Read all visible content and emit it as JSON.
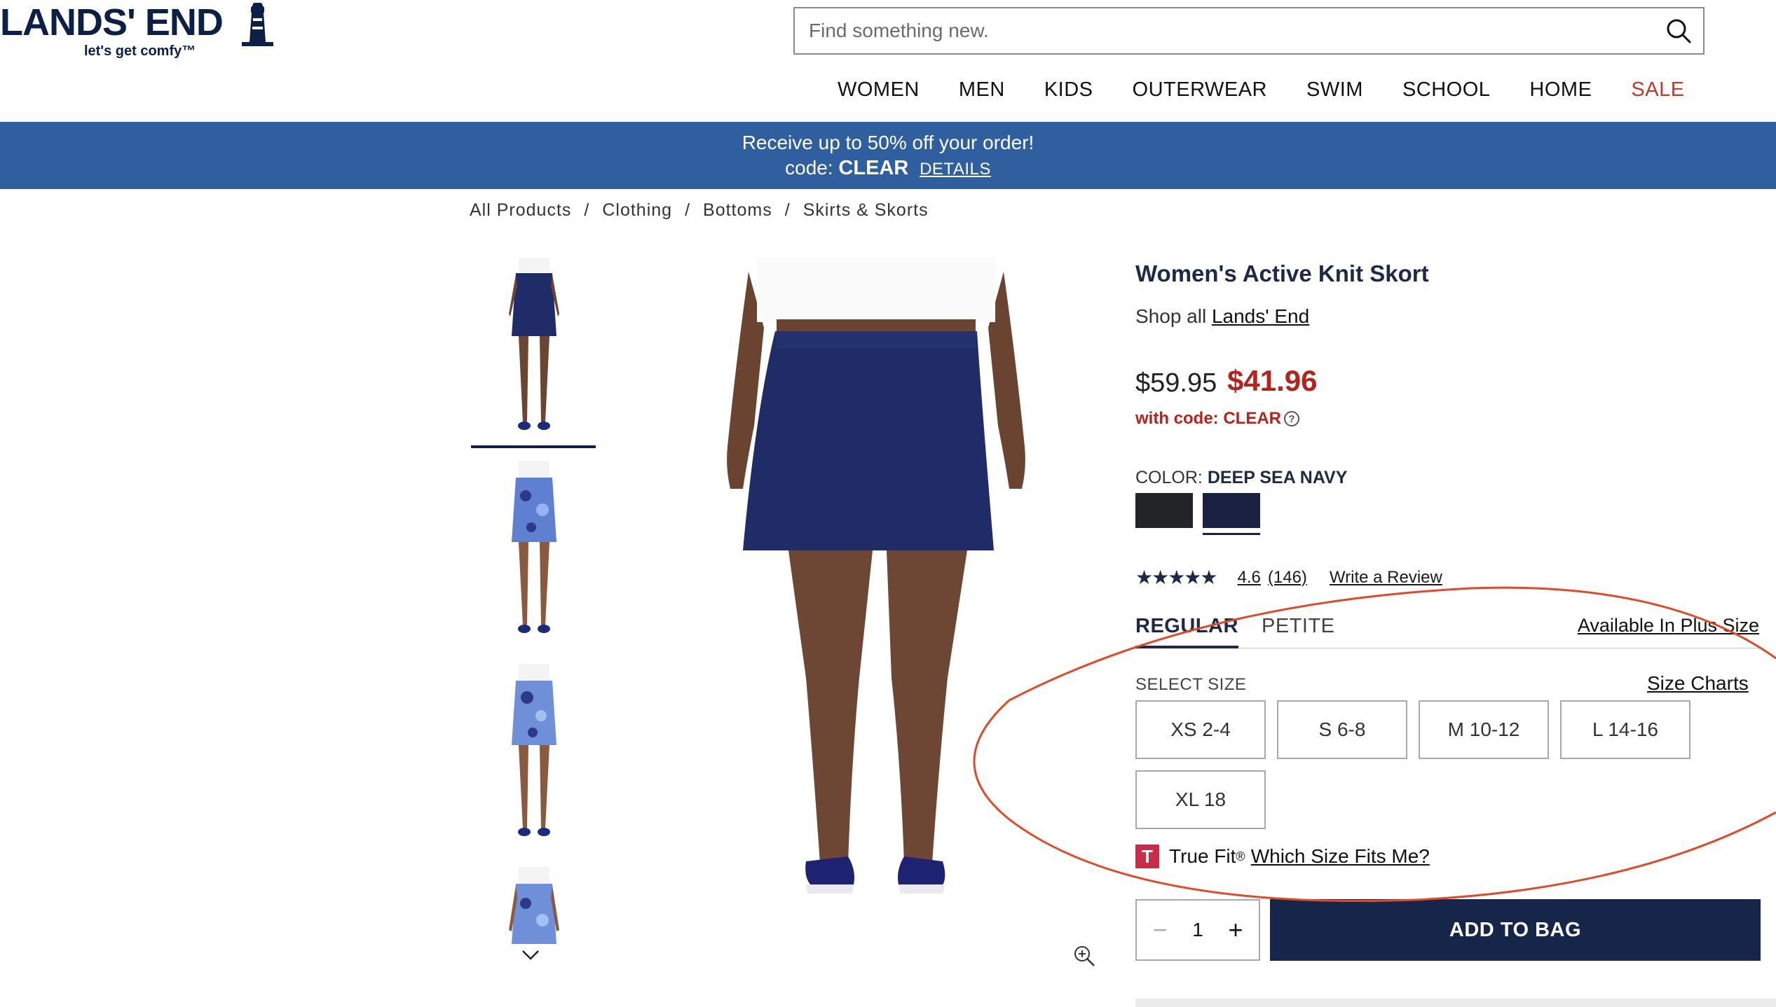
{
  "header": {
    "logo_text": "LANDS' END",
    "logo_tagline": "let's get comfy™",
    "search_placeholder": "Find something new.",
    "nav": [
      {
        "label": "WOMEN"
      },
      {
        "label": "MEN"
      },
      {
        "label": "KIDS"
      },
      {
        "label": "OUTERWEAR"
      },
      {
        "label": "SWIM"
      },
      {
        "label": "SCHOOL"
      },
      {
        "label": "HOME"
      },
      {
        "label": "SALE"
      }
    ]
  },
  "promo": {
    "line1": "Receive up to 50% off your order!",
    "code_prefix": "code:",
    "code": "CLEAR",
    "details": "DETAILS"
  },
  "breadcrumb": [
    {
      "label": "All Products"
    },
    {
      "label": "Clothing"
    },
    {
      "label": "Bottoms"
    },
    {
      "label": "Skirts & Skorts"
    }
  ],
  "breadcrumb_separator": "/",
  "product": {
    "title": "Women's Active Knit Skort",
    "shop_all_prefix": "Shop all",
    "brand_link": "Lands' End",
    "original_price": "$59.95",
    "sale_price": "$41.96",
    "with_code": "with code: CLEAR",
    "color_label": "COLOR:",
    "color_value": "DEEP SEA NAVY",
    "swatches": [
      {
        "name": "black",
        "color": "#232428"
      },
      {
        "name": "deep sea navy",
        "color": "#1b2140"
      }
    ],
    "rating_stars": "★★★★★",
    "rating_value": "4.6",
    "review_count": "(146)",
    "write_review": "Write a Review",
    "fit_tabs": [
      {
        "label": "REGULAR"
      },
      {
        "label": "PETITE"
      }
    ],
    "plus_size": "Available In Plus Size",
    "select_size_label": "SELECT SIZE",
    "size_charts": "Size Charts",
    "sizes": [
      {
        "label": "XS 2-4"
      },
      {
        "label": "S 6-8"
      },
      {
        "label": "M 10-12"
      },
      {
        "label": "L 14-16"
      },
      {
        "label": "XL 18"
      }
    ],
    "truefit_logo": "T",
    "truefit_label": "True Fit",
    "truefit_reg": "®",
    "truefit_link": "Which Size Fits Me?",
    "quantity": "1",
    "qty_minus": "−",
    "qty_plus": "+",
    "add_to_bag": "ADD TO BAG"
  },
  "colors": {
    "brand_navy": "#0e1f45",
    "promo_blue": "#2f5f9e",
    "sale_red": "#b5231d",
    "annotation_red": "#e04a2a"
  }
}
